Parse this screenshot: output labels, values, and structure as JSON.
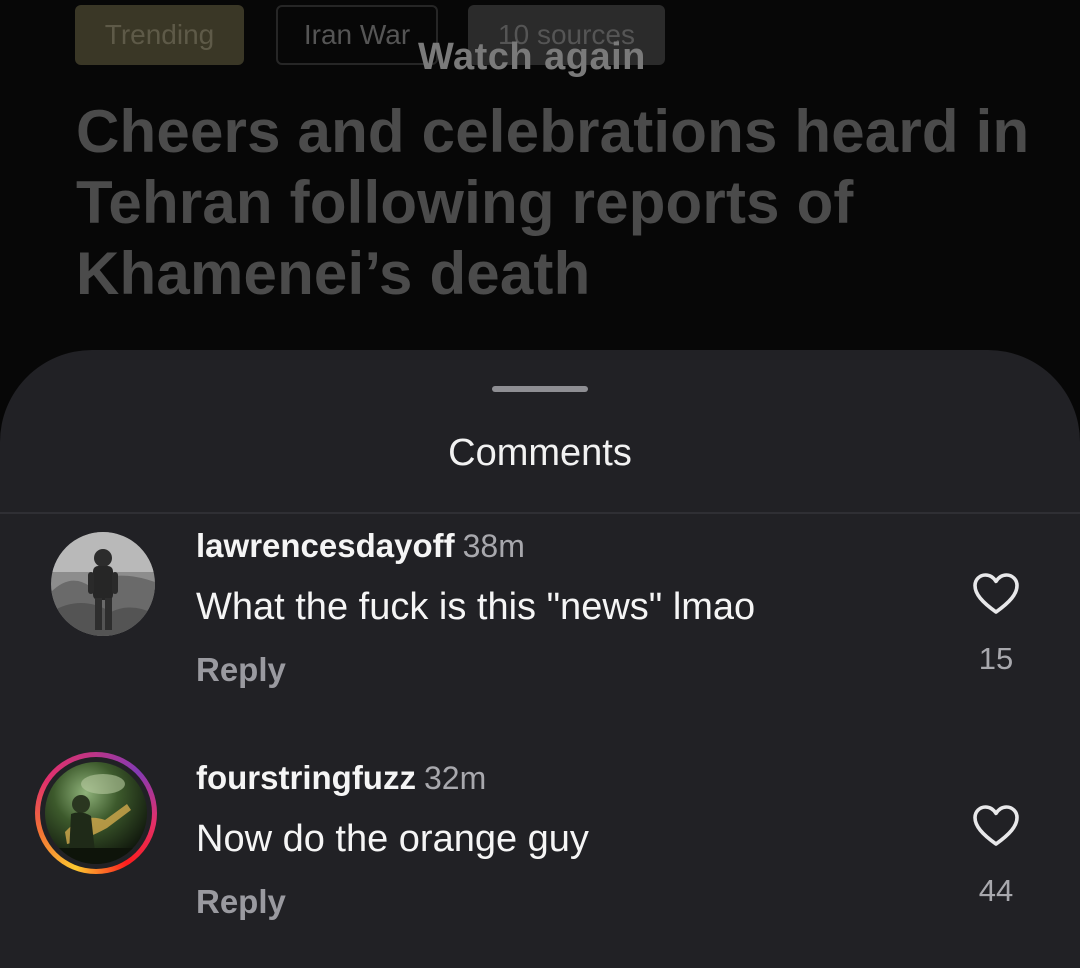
{
  "background": {
    "tags": {
      "trending": "Trending",
      "topic": "Iran War",
      "sources": "10 sources"
    },
    "overlay_label": "Watch again",
    "headline": "Cheers and celebrations heard in Tehran following reports of Khamenei’s death"
  },
  "sheet": {
    "title": "Comments"
  },
  "comments": [
    {
      "username": "lawrencesdayoff",
      "time": "38m",
      "text": "What the fuck is this \"news\" lmao",
      "reply_label": "Reply",
      "likes": "15",
      "has_story_ring": false
    },
    {
      "username": "fourstringfuzz",
      "time": "32m",
      "text": "Now do the orange guy",
      "reply_label": "Reply",
      "likes": "44",
      "has_story_ring": true
    }
  ],
  "icons": {
    "like": "heart-outline-icon"
  },
  "colors": {
    "sheet_background": "#212125",
    "primary_text": "#f5f5f5",
    "secondary_text": "#a8a8ad"
  }
}
